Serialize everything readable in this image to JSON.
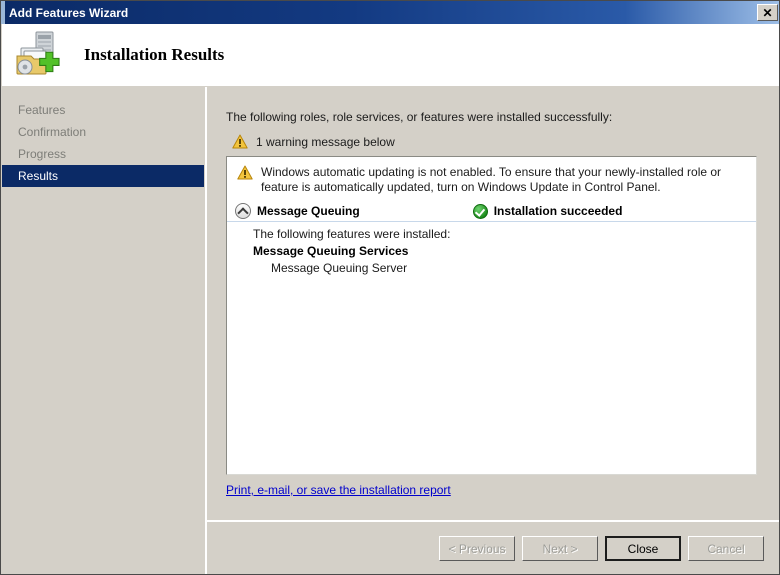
{
  "window": {
    "title": "Add Features Wizard",
    "close_button_glyph": "✕"
  },
  "header": {
    "title": "Installation Results",
    "icon": "server-add-feature-icon"
  },
  "sidebar": {
    "items": [
      {
        "label": "Features",
        "active": false
      },
      {
        "label": "Confirmation",
        "active": false
      },
      {
        "label": "Progress",
        "active": false
      },
      {
        "label": "Results",
        "active": true
      }
    ]
  },
  "content": {
    "intro_text": "The following roles, role services, or features were installed successfully:",
    "warning_summary": "1 warning message below",
    "panel": {
      "warning_message": "Windows automatic updating is not enabled. To ensure that your newly-installed role or feature is automatically updated, turn on Windows Update in Control Panel.",
      "group_name": "Message Queuing",
      "group_status": "Installation succeeded",
      "features_intro": "The following features were installed:",
      "feature_group": "Message Queuing Services",
      "feature_child": "Message Queuing Server"
    },
    "report_link": "Print, e-mail, or save the installation report"
  },
  "footer": {
    "buttons": [
      {
        "label": "< Previous",
        "state": "disabled"
      },
      {
        "label": "Next >",
        "state": "disabled"
      },
      {
        "label": "Close",
        "state": "default"
      },
      {
        "label": "Cancel",
        "state": "disabled"
      }
    ]
  },
  "colors": {
    "titlebar_start": "#0b2a66",
    "dialog_face": "#d4d0c8",
    "accent_selection": "#0b2a66",
    "link": "#0000cc",
    "warning": "#f2c43d",
    "success": "#1a8a1a"
  }
}
